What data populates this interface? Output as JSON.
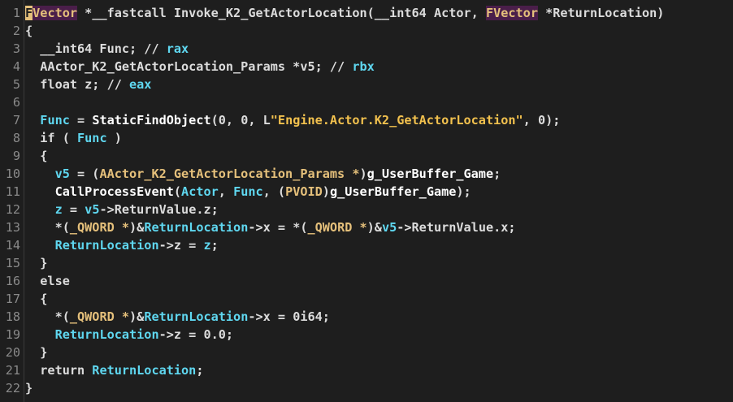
{
  "colors": {
    "background": "#1e1e1e",
    "type_highlight": "#4a1e4a",
    "type": "#e5c07b",
    "variable": "#5fd7f0",
    "string": "#f2c14e",
    "default": "#dcdcdc"
  },
  "lines": [
    {
      "n": "1",
      "tokens": [
        {
          "t": "F",
          "c": "cursor-cell"
        },
        {
          "t": "Vector",
          "c": "tok-typehl"
        },
        {
          "t": " *__fastcall Invoke_K2_GetActorLocation(",
          "c": "tok-text"
        },
        {
          "t": "__int64",
          "c": "tok-text"
        },
        {
          "t": " Actor, ",
          "c": "tok-text"
        },
        {
          "t": "FVector",
          "c": "tok-typehl"
        },
        {
          "t": " *ReturnLocation)",
          "c": "tok-text"
        }
      ]
    },
    {
      "n": "2",
      "tokens": [
        {
          "t": "{",
          "c": "tok-punc"
        }
      ]
    },
    {
      "n": "3",
      "tokens": [
        {
          "t": "  __int64 Func; // ",
          "c": "tok-text"
        },
        {
          "t": "rax",
          "c": "tok-reg"
        }
      ]
    },
    {
      "n": "4",
      "tokens": [
        {
          "t": "  AActor_K2_GetActorLocation_Params *v5; // ",
          "c": "tok-text"
        },
        {
          "t": "rbx",
          "c": "tok-reg"
        }
      ]
    },
    {
      "n": "5",
      "tokens": [
        {
          "t": "  float z; // ",
          "c": "tok-text"
        },
        {
          "t": "eax",
          "c": "tok-reg"
        }
      ]
    },
    {
      "n": "6",
      "tokens": []
    },
    {
      "n": "7",
      "tokens": [
        {
          "t": "  ",
          "c": "tok-text"
        },
        {
          "t": "Func",
          "c": "tok-var"
        },
        {
          "t": " = ",
          "c": "tok-text"
        },
        {
          "t": "StaticFindObject",
          "c": "tok-func"
        },
        {
          "t": "(0, 0, L",
          "c": "tok-text"
        },
        {
          "t": "\"Engine.Actor.K2_GetActorLocation\"",
          "c": "tok-str"
        },
        {
          "t": ", 0);",
          "c": "tok-text"
        }
      ]
    },
    {
      "n": "8",
      "tokens": [
        {
          "t": "  if ( ",
          "c": "tok-text"
        },
        {
          "t": "Func",
          "c": "tok-var"
        },
        {
          "t": " )",
          "c": "tok-text"
        }
      ]
    },
    {
      "n": "9",
      "tokens": [
        {
          "t": "  {",
          "c": "tok-punc"
        }
      ]
    },
    {
      "n": "10",
      "tokens": [
        {
          "t": "    ",
          "c": "tok-text"
        },
        {
          "t": "v5",
          "c": "tok-var"
        },
        {
          "t": " = (",
          "c": "tok-text"
        },
        {
          "t": "AActor_K2_GetActorLocation_Params *",
          "c": "tok-type"
        },
        {
          "t": ")",
          "c": "tok-text"
        },
        {
          "t": "g_UserBuffer_Game",
          "c": "tok-glob"
        },
        {
          "t": ";",
          "c": "tok-text"
        }
      ]
    },
    {
      "n": "11",
      "tokens": [
        {
          "t": "    ",
          "c": "tok-text"
        },
        {
          "t": "CallProcessEvent",
          "c": "tok-func"
        },
        {
          "t": "(",
          "c": "tok-text"
        },
        {
          "t": "Actor",
          "c": "tok-var"
        },
        {
          "t": ", ",
          "c": "tok-text"
        },
        {
          "t": "Func",
          "c": "tok-var"
        },
        {
          "t": ", (",
          "c": "tok-text"
        },
        {
          "t": "PVOID",
          "c": "tok-type"
        },
        {
          "t": ")",
          "c": "tok-text"
        },
        {
          "t": "g_UserBuffer_Game",
          "c": "tok-glob"
        },
        {
          "t": ");",
          "c": "tok-text"
        }
      ]
    },
    {
      "n": "12",
      "tokens": [
        {
          "t": "    ",
          "c": "tok-text"
        },
        {
          "t": "z",
          "c": "tok-var"
        },
        {
          "t": " = ",
          "c": "tok-text"
        },
        {
          "t": "v5",
          "c": "tok-var"
        },
        {
          "t": "->ReturnValue.z;",
          "c": "tok-text"
        }
      ]
    },
    {
      "n": "13",
      "tokens": [
        {
          "t": "    *(",
          "c": "tok-text"
        },
        {
          "t": "_QWORD *",
          "c": "tok-type"
        },
        {
          "t": ")&",
          "c": "tok-text"
        },
        {
          "t": "ReturnLocation",
          "c": "tok-var"
        },
        {
          "t": "->x = *(",
          "c": "tok-text"
        },
        {
          "t": "_QWORD *",
          "c": "tok-type"
        },
        {
          "t": ")&",
          "c": "tok-text"
        },
        {
          "t": "v5",
          "c": "tok-var"
        },
        {
          "t": "->ReturnValue.x;",
          "c": "tok-text"
        }
      ]
    },
    {
      "n": "14",
      "tokens": [
        {
          "t": "    ",
          "c": "tok-text"
        },
        {
          "t": "ReturnLocation",
          "c": "tok-var"
        },
        {
          "t": "->z = ",
          "c": "tok-text"
        },
        {
          "t": "z",
          "c": "tok-var"
        },
        {
          "t": ";",
          "c": "tok-text"
        }
      ]
    },
    {
      "n": "15",
      "tokens": [
        {
          "t": "  }",
          "c": "tok-punc"
        }
      ]
    },
    {
      "n": "16",
      "tokens": [
        {
          "t": "  else",
          "c": "tok-text"
        }
      ]
    },
    {
      "n": "17",
      "tokens": [
        {
          "t": "  {",
          "c": "tok-punc"
        }
      ]
    },
    {
      "n": "18",
      "tokens": [
        {
          "t": "    *(",
          "c": "tok-text"
        },
        {
          "t": "_QWORD *",
          "c": "tok-type"
        },
        {
          "t": ")&",
          "c": "tok-text"
        },
        {
          "t": "ReturnLocation",
          "c": "tok-var"
        },
        {
          "t": "->x = 0i64;",
          "c": "tok-text"
        }
      ]
    },
    {
      "n": "19",
      "tokens": [
        {
          "t": "    ",
          "c": "tok-text"
        },
        {
          "t": "ReturnLocation",
          "c": "tok-var"
        },
        {
          "t": "->z = 0.0;",
          "c": "tok-text"
        }
      ]
    },
    {
      "n": "20",
      "tokens": [
        {
          "t": "  }",
          "c": "tok-punc"
        }
      ]
    },
    {
      "n": "21",
      "tokens": [
        {
          "t": "  return ",
          "c": "tok-text"
        },
        {
          "t": "ReturnLocation",
          "c": "tok-var"
        },
        {
          "t": ";",
          "c": "tok-text"
        }
      ]
    },
    {
      "n": "22",
      "tokens": [
        {
          "t": "}",
          "c": "tok-punc"
        }
      ]
    }
  ]
}
